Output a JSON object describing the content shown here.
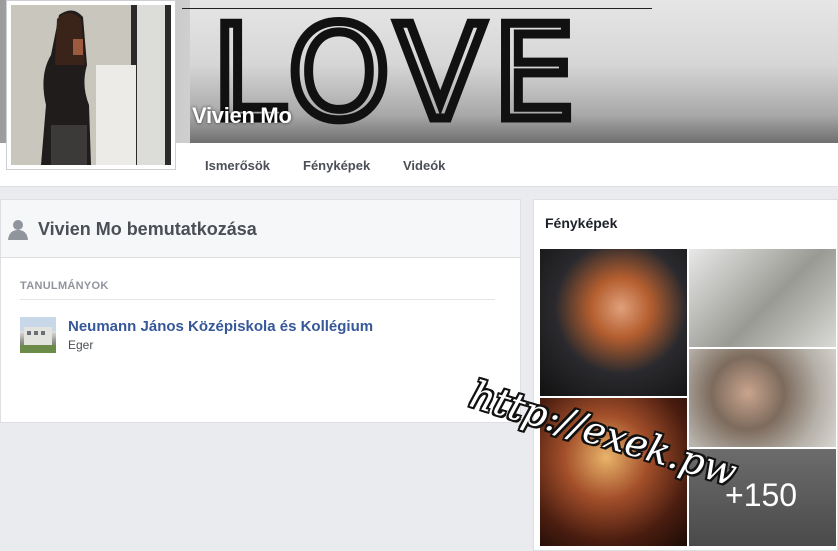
{
  "profile": {
    "name": "Vivien Mo",
    "cover_text": "LOVE"
  },
  "nav": {
    "friends": "Ismerősök",
    "photos": "Fényképek",
    "videos": "Videók"
  },
  "intro": {
    "title": "Vivien Mo bemutatkozása",
    "section_label": "TANULMÁNYOK",
    "school": {
      "name": "Neumann János Középiskola és Kollégium",
      "city": "Eger"
    }
  },
  "photos": {
    "title": "Fényképek",
    "more_count": "+150"
  },
  "watermark": "http://exek.pw",
  "colors": {
    "link": "#365899",
    "background": "#e9ebee",
    "header_text": "#4b4f56"
  },
  "icons": {
    "person": "person-icon"
  }
}
